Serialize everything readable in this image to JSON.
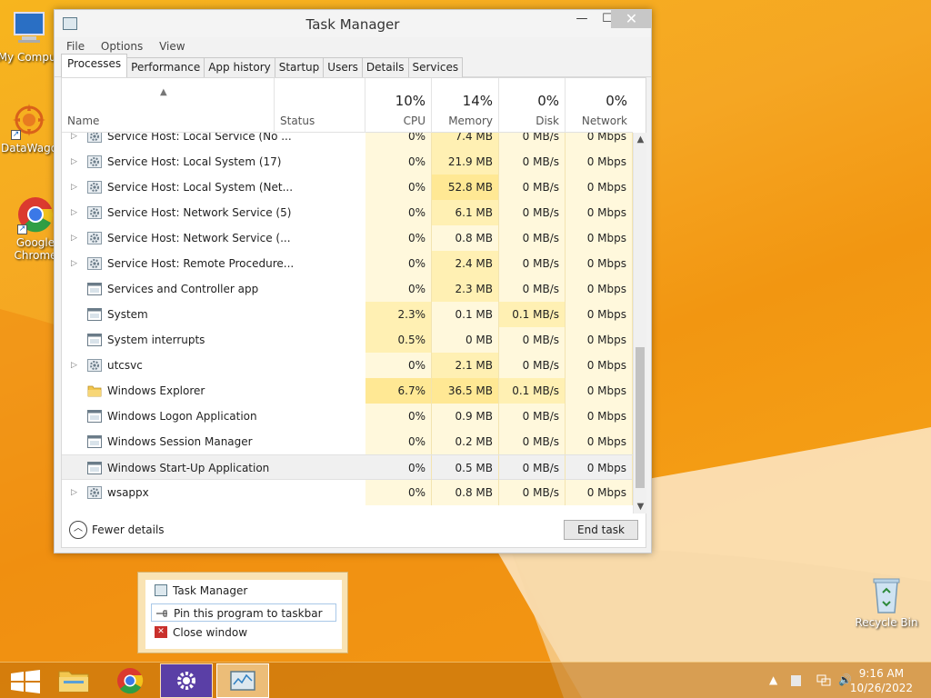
{
  "desktop": {
    "icons": [
      {
        "label": "My Comput"
      },
      {
        "label": "DataWago"
      },
      {
        "label": "Google Chrome"
      },
      {
        "label": "Recycle Bin"
      }
    ]
  },
  "window": {
    "title": "Task Manager",
    "menu": [
      "File",
      "Options",
      "View"
    ],
    "tabs": [
      "Processes",
      "Performance",
      "App history",
      "Startup",
      "Users",
      "Details",
      "Services"
    ],
    "active_tab": "Processes"
  },
  "table": {
    "headers": {
      "name": "Name",
      "status": "Status",
      "cpu": {
        "pct": "10%",
        "label": "CPU"
      },
      "memory": {
        "pct": "14%",
        "label": "Memory"
      },
      "disk": {
        "pct": "0%",
        "label": "Disk"
      },
      "network": {
        "pct": "0%",
        "label": "Network"
      }
    },
    "rows": [
      {
        "name": "Service Host: Local Service (No ...",
        "cpu": "0%",
        "memory": "7.4 MB",
        "disk": "0 MB/s",
        "network": "0 Mbps",
        "icon": "gear-icon",
        "expandable": true
      },
      {
        "name": "Service Host: Local System (17)",
        "cpu": "0%",
        "memory": "21.9 MB",
        "disk": "0 MB/s",
        "network": "0 Mbps",
        "icon": "gear-icon",
        "expandable": true
      },
      {
        "name": "Service Host: Local System (Net...",
        "cpu": "0%",
        "memory": "52.8 MB",
        "disk": "0 MB/s",
        "network": "0 Mbps",
        "icon": "gear-icon",
        "expandable": true
      },
      {
        "name": "Service Host: Network Service (5)",
        "cpu": "0%",
        "memory": "6.1 MB",
        "disk": "0 MB/s",
        "network": "0 Mbps",
        "icon": "gear-icon",
        "expandable": true
      },
      {
        "name": "Service Host: Network Service (...",
        "cpu": "0%",
        "memory": "0.8 MB",
        "disk": "0 MB/s",
        "network": "0 Mbps",
        "icon": "gear-icon",
        "expandable": true
      },
      {
        "name": "Service Host: Remote Procedure...",
        "cpu": "0%",
        "memory": "2.4 MB",
        "disk": "0 MB/s",
        "network": "0 Mbps",
        "icon": "gear-icon",
        "expandable": true
      },
      {
        "name": "Services and Controller app",
        "cpu": "0%",
        "memory": "2.3 MB",
        "disk": "0 MB/s",
        "network": "0 Mbps",
        "icon": "window-icon",
        "expandable": false
      },
      {
        "name": "System",
        "cpu": "2.3%",
        "memory": "0.1 MB",
        "disk": "0.1 MB/s",
        "network": "0 Mbps",
        "icon": "window-icon",
        "expandable": false
      },
      {
        "name": "System interrupts",
        "cpu": "0.5%",
        "memory": "0 MB",
        "disk": "0 MB/s",
        "network": "0 Mbps",
        "icon": "window-icon",
        "expandable": false
      },
      {
        "name": "utcsvc",
        "cpu": "0%",
        "memory": "2.1 MB",
        "disk": "0 MB/s",
        "network": "0 Mbps",
        "icon": "gear-icon",
        "expandable": true
      },
      {
        "name": "Windows Explorer",
        "cpu": "6.7%",
        "memory": "36.5 MB",
        "disk": "0.1 MB/s",
        "network": "0 Mbps",
        "icon": "folder-icon",
        "expandable": false
      },
      {
        "name": "Windows Logon Application",
        "cpu": "0%",
        "memory": "0.9 MB",
        "disk": "0 MB/s",
        "network": "0 Mbps",
        "icon": "window-icon",
        "expandable": false
      },
      {
        "name": "Windows Session Manager",
        "cpu": "0%",
        "memory": "0.2 MB",
        "disk": "0 MB/s",
        "network": "0 Mbps",
        "icon": "window-icon",
        "expandable": false
      },
      {
        "name": "Windows Start-Up Application",
        "cpu": "0%",
        "memory": "0.5 MB",
        "disk": "0 MB/s",
        "network": "0 Mbps",
        "icon": "window-icon",
        "expandable": false,
        "selected": true
      },
      {
        "name": "wsappx",
        "cpu": "0%",
        "memory": "0.8 MB",
        "disk": "0 MB/s",
        "network": "0 Mbps",
        "icon": "gear-icon",
        "expandable": true
      }
    ]
  },
  "footer": {
    "fewer_details": "Fewer details",
    "end_task": "End task"
  },
  "jump_list": {
    "items": [
      "Task Manager",
      "Pin this program to taskbar",
      "Close window"
    ]
  },
  "taskbar": {
    "time": "9:16 AM",
    "date": "10/26/2022"
  },
  "colors": {
    "heat_light": "#fff8dc",
    "heat_mid": "#fff0b3",
    "heat_strong": "#ffe894"
  }
}
